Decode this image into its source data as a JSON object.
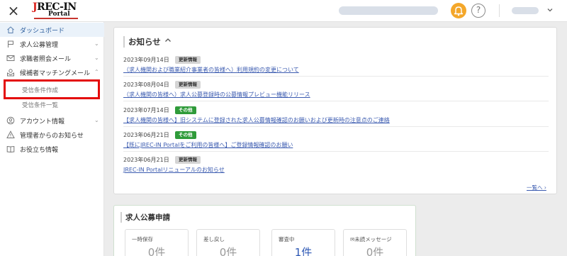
{
  "header": {
    "close_label": "×",
    "logo": {
      "line1_red": "J",
      "line1_rest": "REC-IN",
      "line2": "Portal"
    },
    "bell_icon": "bell-icon",
    "help_label": "?",
    "account_chevron": "⌄"
  },
  "sidebar": {
    "items": [
      {
        "label": "ダッシュボード",
        "icon": "home-icon",
        "chevron": ""
      },
      {
        "label": "求人公募管理",
        "icon": "flag-icon",
        "chevron": "⌄"
      },
      {
        "label": "求職者照会メール",
        "icon": "mail-icon",
        "chevron": "⌄"
      },
      {
        "label": "候補者マッチングメール",
        "icon": "mail-match-icon",
        "chevron": "⌃"
      },
      {
        "label": "アカウント情報",
        "icon": "account-icon",
        "chevron": "⌄"
      },
      {
        "label": "管理者からのお知らせ",
        "icon": "warning-icon",
        "chevron": ""
      },
      {
        "label": "お役立ち情報",
        "icon": "book-icon",
        "chevron": ""
      }
    ],
    "sub_items": [
      {
        "label": "受信条件作成"
      },
      {
        "label": "受信条件一覧"
      }
    ]
  },
  "notices": {
    "title": "お知らせ",
    "toggle": "^",
    "items": [
      {
        "date": "2023年09月14日",
        "badge": "更新情報",
        "badge_type": "update",
        "link": "（求人機関および職業紹介事業者の皆様へ）利用規約の変更について"
      },
      {
        "date": "2023年08月04日",
        "badge": "更新情報",
        "badge_type": "update",
        "link": "（求人機関の皆様へ）求人公募登録時の公募情報プレビュー機能リリース"
      },
      {
        "date": "2023年07月14日",
        "badge": "その他",
        "badge_type": "other",
        "link": "【求人機関の皆様へ】旧システムに登録された求人公募情報確認のお願いおよび更新時の注意点のご連絡"
      },
      {
        "date": "2023年06月21日",
        "badge": "その他",
        "badge_type": "other",
        "link": "【既にJREC-IN Portalをご利用の皆様へ】ご登録情報確認のお願い"
      },
      {
        "date": "2023年06月21日",
        "badge": "更新情報",
        "badge_type": "update",
        "link": "JREC-IN Portalリニューアルのお知らせ"
      }
    ],
    "more_link": "一覧へ ›"
  },
  "application": {
    "title": "求人公募申請",
    "cards": [
      {
        "label": "一時保存",
        "value": "0件",
        "highlight": false
      },
      {
        "label": "差し戻し",
        "value": "0件",
        "highlight": false
      },
      {
        "label": "審査中",
        "value": "1件",
        "highlight": true
      },
      {
        "label": "✉未読メッセージ",
        "value": "0件",
        "highlight": false
      }
    ]
  },
  "colors": {
    "accent_red": "#e40a0a",
    "badge_other": "#2f9b3a",
    "link_blue": "#3b5bb0",
    "bell_orange": "#f4a72a"
  }
}
